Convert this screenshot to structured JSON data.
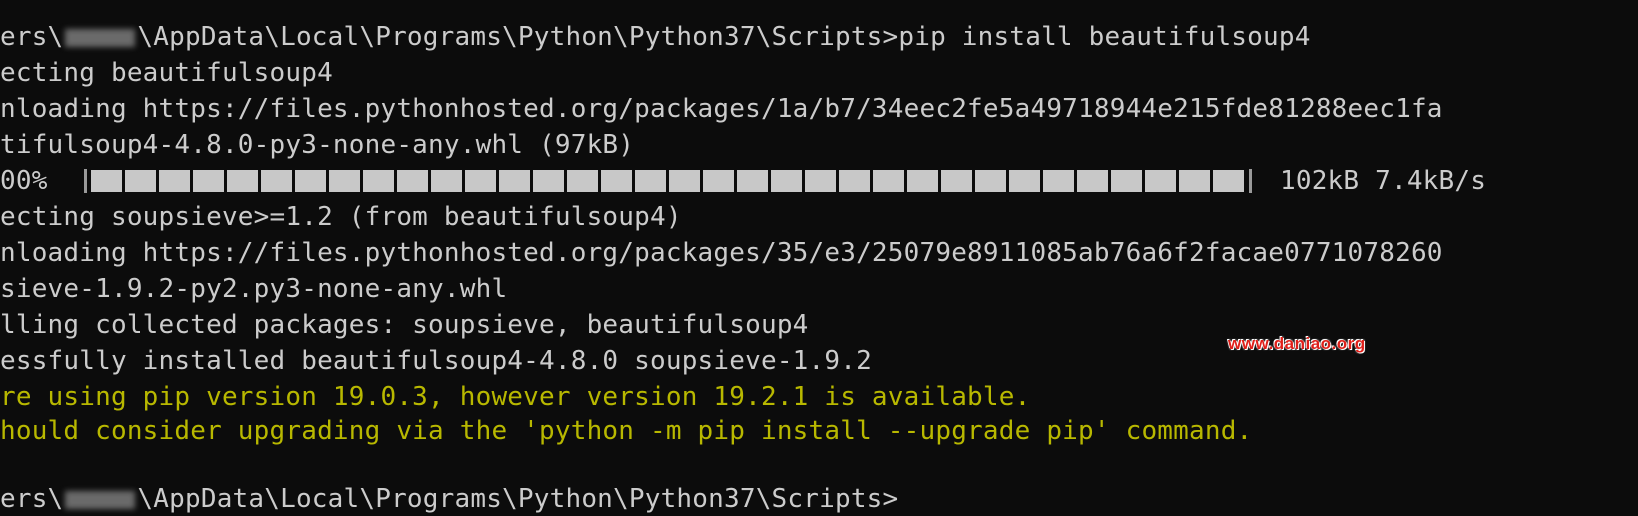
{
  "terminal": {
    "prompt_prefix": "ers\\",
    "prompt_path": "\\AppData\\Local\\Programs\\Python\\Python37\\Scripts>",
    "command": "pip install beautifulsoup4",
    "collect1": "ecting beautifulsoup4",
    "download1": "nloading https://files.pythonhosted.org/packages/1a/b7/34eec2fe5a49718944e215fde81288eec1fa",
    "file1": "tifulsoup4-4.8.0-py3-none-any.whl (97kB)",
    "progress_percent_label": "00%",
    "progress_value": 1.0,
    "progress_stats": "102kB 7.4kB/s",
    "collect2": "ecting soupsieve>=1.2 (from beautifulsoup4)",
    "download2": "nloading https://files.pythonhosted.org/packages/35/e3/25079e8911085ab76a6f2facae0771078260",
    "file2": "sieve-1.9.2-py2.py3-none-any.whl",
    "installing": "lling collected packages: soupsieve, beautifulsoup4",
    "success": "essfully installed beautifulsoup4-4.8.0 soupsieve-1.9.2",
    "warning1": "re using pip version 19.0.3, however version 19.2.1 is available.",
    "warning2": "hould consider upgrading via the 'python -m pip install --upgrade pip' command.",
    "prompt2_prefix": "ers\\",
    "prompt2_path": "\\AppData\\Local\\Programs\\Python\\Python37\\Scripts>"
  },
  "watermark": "www.daniao.org",
  "colors": {
    "background": "#0c0c0c",
    "text": "#cccccc",
    "warning": "#b8b800",
    "progress_block": "#c8c8c8",
    "watermark": "#e0201a"
  }
}
